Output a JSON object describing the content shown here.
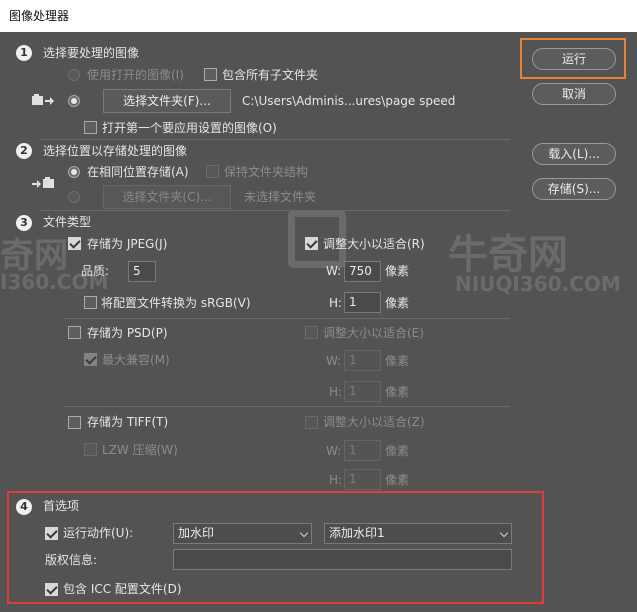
{
  "window": {
    "title": "图像处理器"
  },
  "buttons": {
    "run": "运行",
    "cancel": "取消",
    "load": "载入(L)...",
    "save": "存储(S)..."
  },
  "section1": {
    "number": "1",
    "title": "选择要处理的图像",
    "use_open_images": "使用打开的图像(I)",
    "include_subfolders": "包含所有子文件夹",
    "select_folder_button": "选择文件夹(F)...",
    "folder_path": "C:\\Users\\Adminis...ures\\page speed",
    "open_first_image": "打开第一个要应用设置的图像(O)"
  },
  "section2": {
    "number": "2",
    "title": "选择位置以存储处理的图像",
    "save_same_location": "在相同位置存储(A)",
    "keep_folder_structure": "保持文件夹结构",
    "select_folder_button": "选择文件夹(C)...",
    "no_folder_selected": "未选择文件夹"
  },
  "section3": {
    "number": "3",
    "title": "文件类型",
    "jpeg": {
      "save_as": "存储为 JPEG(J)",
      "resize_to_fit": "调整大小以适合(R)",
      "quality_label": "品质:",
      "quality_value": "5",
      "w_label": "W:",
      "w_value": "750",
      "h_label": "H:",
      "h_value": "1",
      "unit_w": "像素",
      "unit_h": "像素",
      "convert_srgb": "将配置文件转换为 sRGB(V)"
    },
    "psd": {
      "save_as": "存储为 PSD(P)",
      "resize_to_fit": "调整大小以适合(E)",
      "max_compat": "最大兼容(M)",
      "w_label": "W:",
      "w_value": "1",
      "h_label": "H:",
      "h_value": "1",
      "unit_w": "像素",
      "unit_h": "像素"
    },
    "tiff": {
      "save_as": "存储为 TIFF(T)",
      "resize_to_fit": "调整大小以适合(Z)",
      "lzw": "LZW 压缩(W)",
      "w_label": "W:",
      "w_value": "1",
      "h_label": "H:",
      "h_value": "1",
      "unit_w": "像素",
      "unit_h": "像素"
    }
  },
  "section4": {
    "number": "4",
    "title": "首选项",
    "run_action": "运行动作(U):",
    "action_set": "加水印",
    "action_name": "添加水印1",
    "copyright_label": "版权信息:",
    "copyright_value": "",
    "include_icc": "包含 ICC 配置文件(D)"
  },
  "watermark": {
    "brand": "牛奇网",
    "domain_left": "I360.COM",
    "domain_right": "NIUQI360.COM",
    "logo_letter": "N"
  },
  "colors": {
    "highlight_orange": "#e8843a",
    "highlight_red": "#e23b3b",
    "bg": "#535353"
  }
}
